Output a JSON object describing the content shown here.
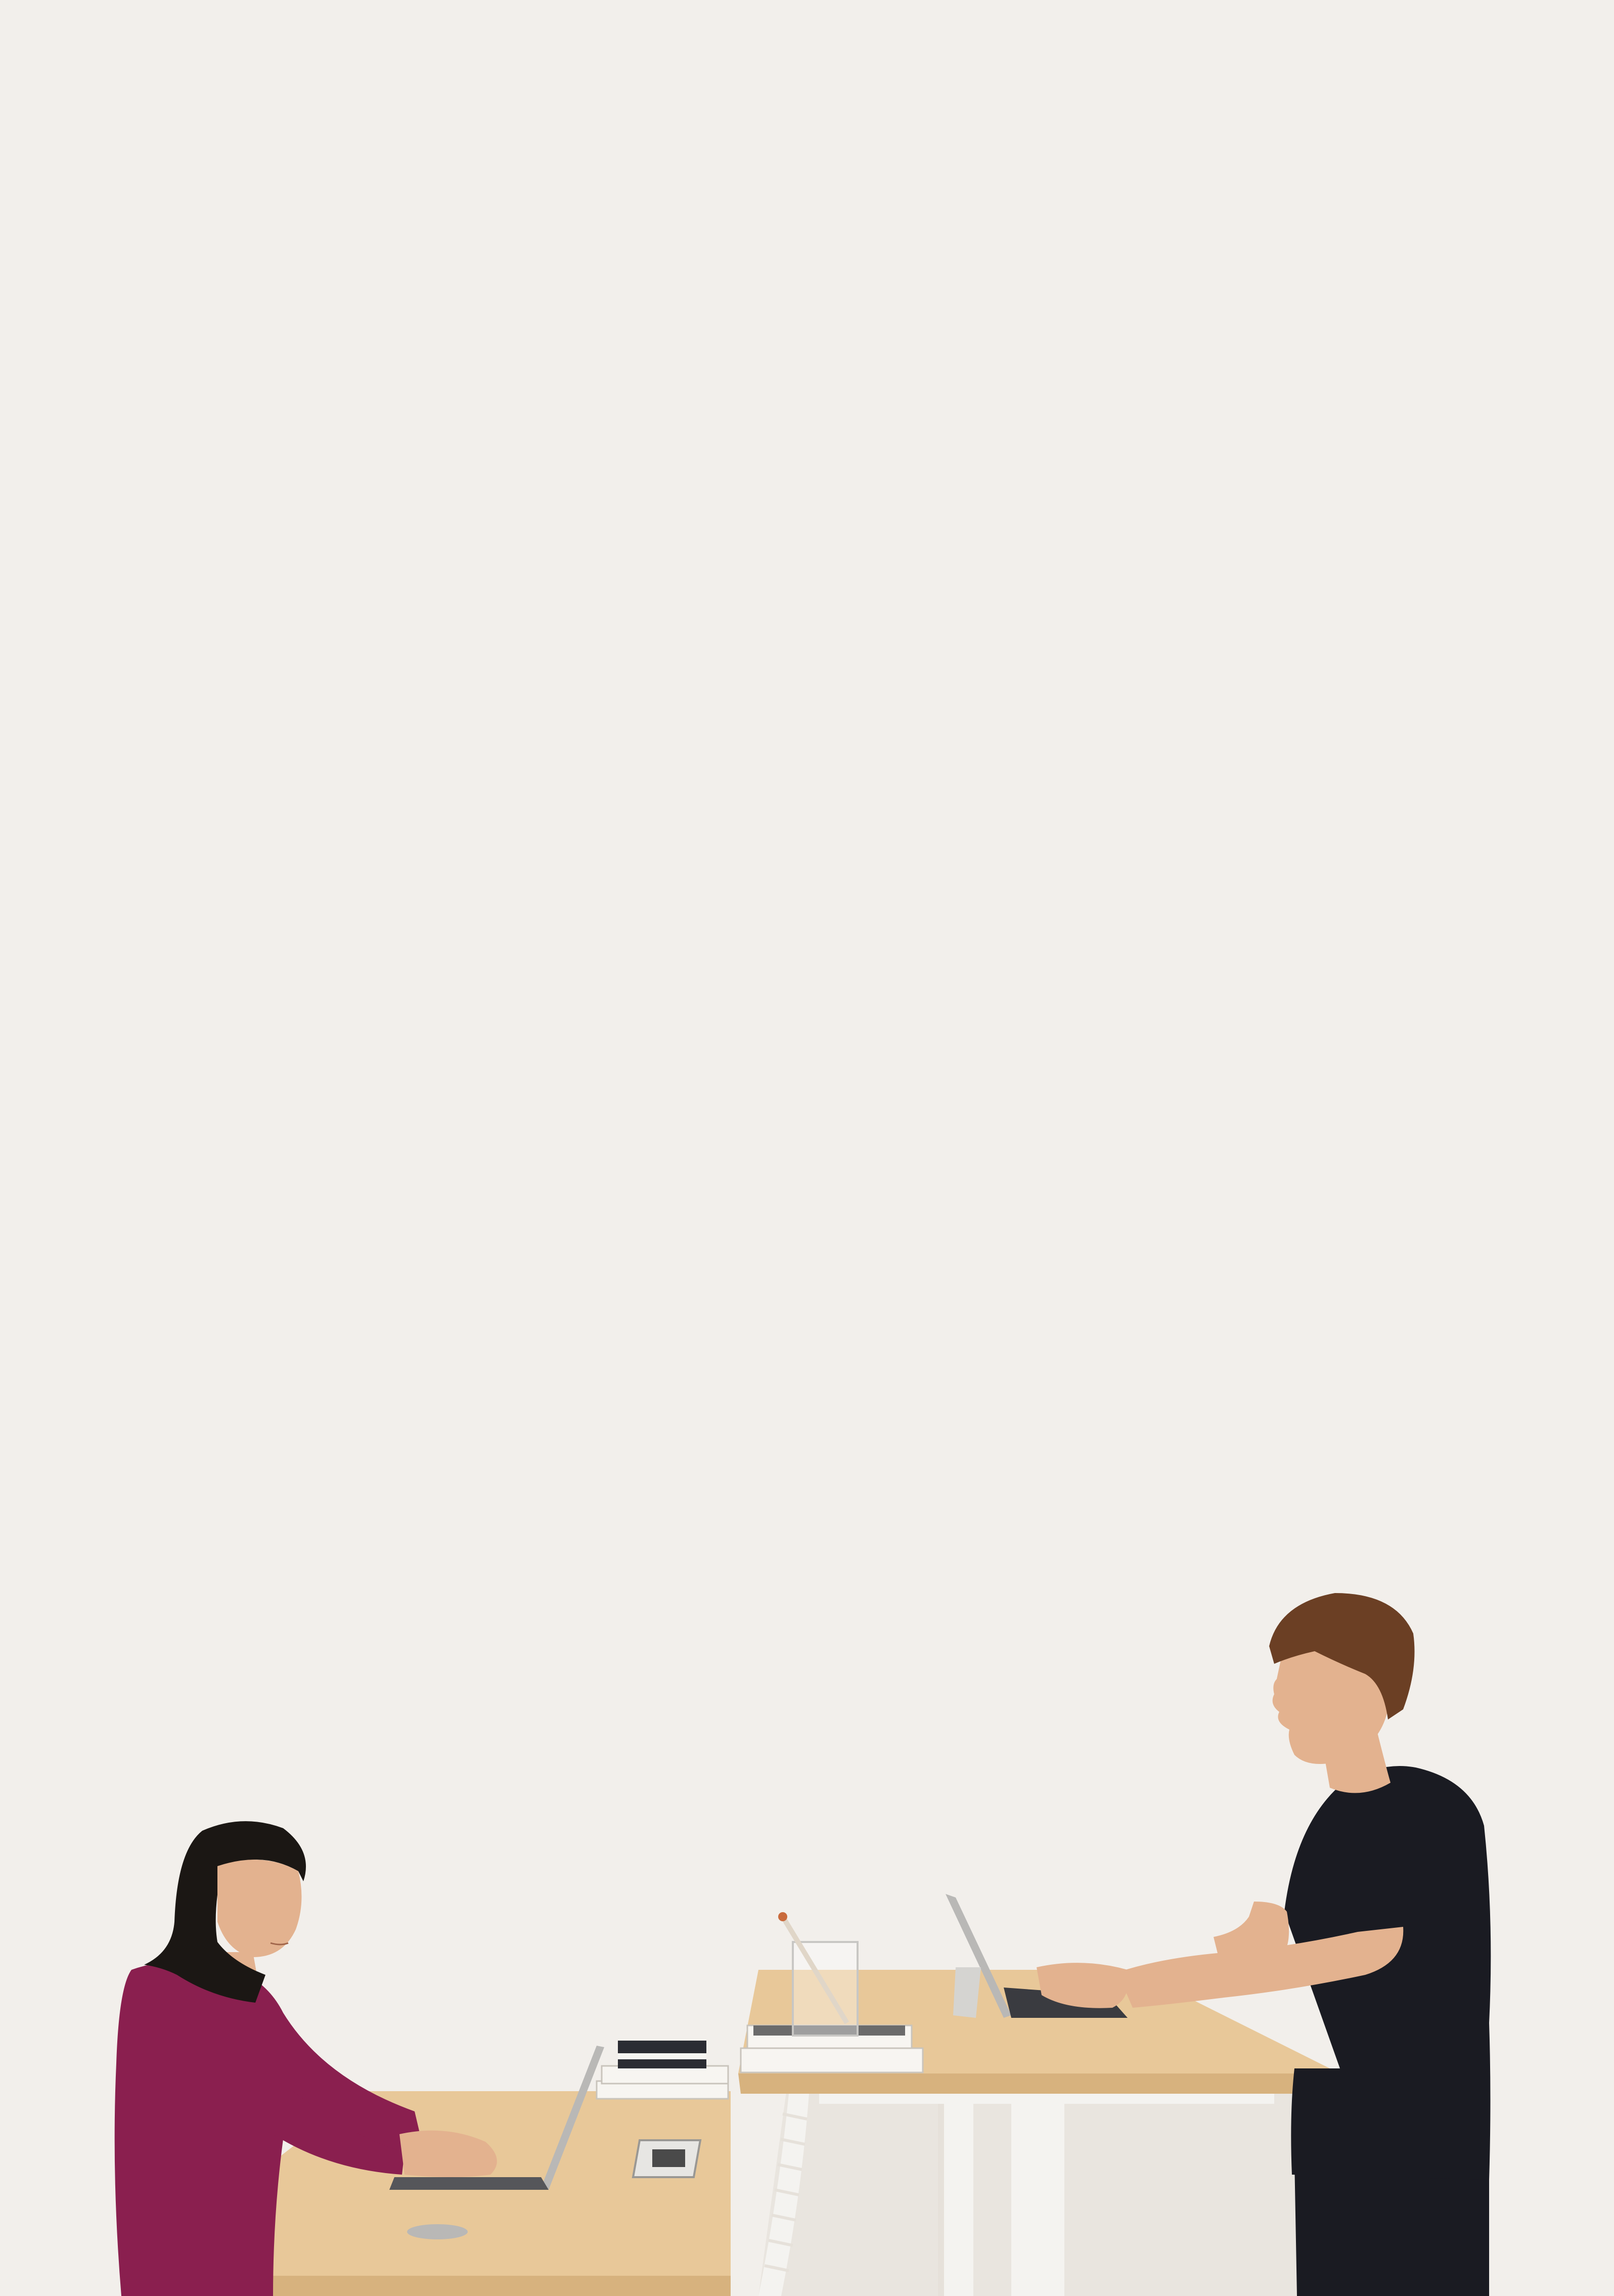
{
  "scene": {
    "subject": "photo",
    "colors": {
      "background": "#f2efeb",
      "wood": "#e8c899",
      "wood_edge": "#d7b27e",
      "leg": "#f4f3f0",
      "shadow": "#e6e1da",
      "sweater": "#8a1f4f",
      "hair": "#1b1714",
      "skin": "#e3b28f",
      "tshirt": "#1a1b22",
      "man_hair": "#6b3f24",
      "laptop": "#b9b8b6",
      "paper": "#f7f5f1"
    },
    "icons": [
      "woman-figure-icon",
      "man-figure-icon",
      "laptop-icon",
      "tablet-icon",
      "glass-icon",
      "books-icon",
      "phone-icon",
      "cable-spine-icon"
    ]
  }
}
